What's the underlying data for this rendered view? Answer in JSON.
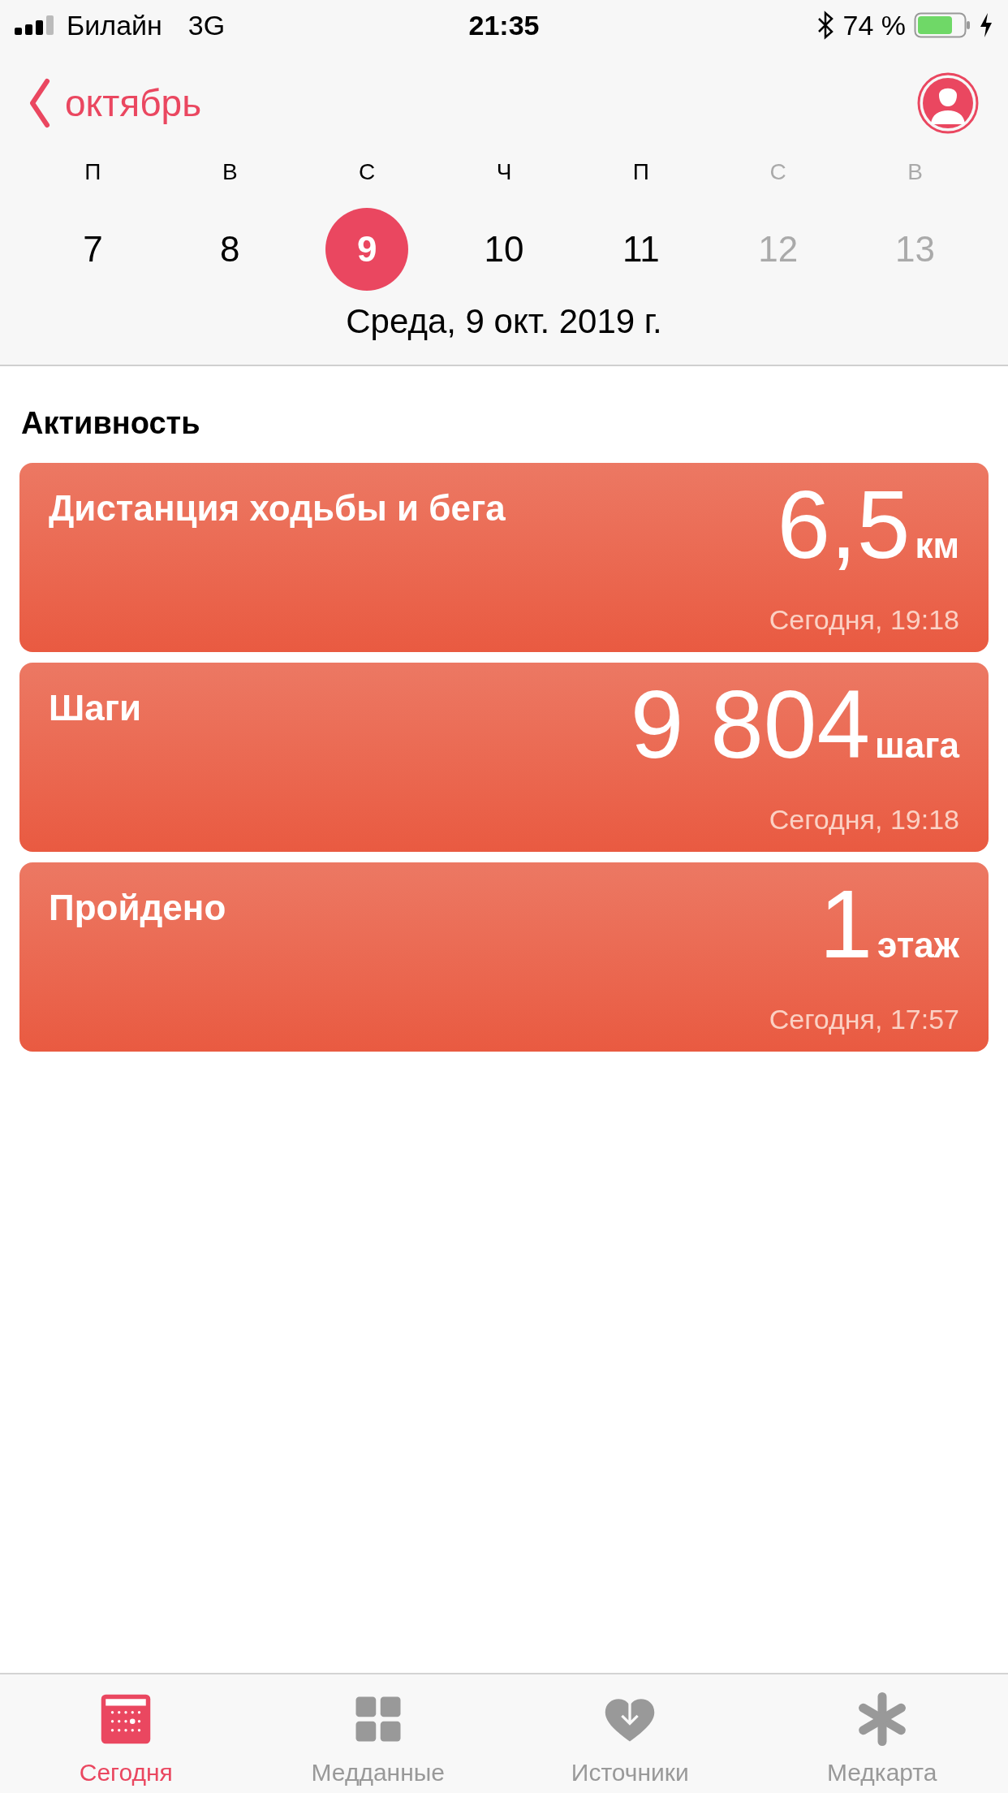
{
  "status_bar": {
    "carrier": "Билайн",
    "network": "3G",
    "time": "21:35",
    "battery": "74 %"
  },
  "nav": {
    "back_label": "октябрь"
  },
  "week": [
    {
      "weekday": "П",
      "day": "7",
      "selected": false,
      "disabled": false
    },
    {
      "weekday": "В",
      "day": "8",
      "selected": false,
      "disabled": false
    },
    {
      "weekday": "С",
      "day": "9",
      "selected": true,
      "disabled": false
    },
    {
      "weekday": "Ч",
      "day": "10",
      "selected": false,
      "disabled": false
    },
    {
      "weekday": "П",
      "day": "11",
      "selected": false,
      "disabled": false
    },
    {
      "weekday": "С",
      "day": "12",
      "selected": false,
      "disabled": true
    },
    {
      "weekday": "В",
      "day": "13",
      "selected": false,
      "disabled": true
    }
  ],
  "date_label": "Среда, 9 окт. 2019 г.",
  "section_title": "Активность",
  "cards": [
    {
      "title": "Дистанция ходьбы и бега",
      "value": "6,5",
      "unit": "км",
      "time": "Сегодня, 19:18"
    },
    {
      "title": "Шаги",
      "value": "9 804",
      "unit": "шага",
      "time": "Сегодня, 19:18"
    },
    {
      "title": "Пройдено",
      "value": "1",
      "unit": "этаж",
      "time": "Сегодня, 17:57"
    }
  ],
  "tab_bar": [
    {
      "kind": "today",
      "label": "Сегодня",
      "selected": true
    },
    {
      "kind": "data",
      "label": "Медданные",
      "selected": false
    },
    {
      "kind": "sources",
      "label": "Источники",
      "selected": false
    },
    {
      "kind": "medical",
      "label": "Медкарта",
      "selected": false
    }
  ]
}
